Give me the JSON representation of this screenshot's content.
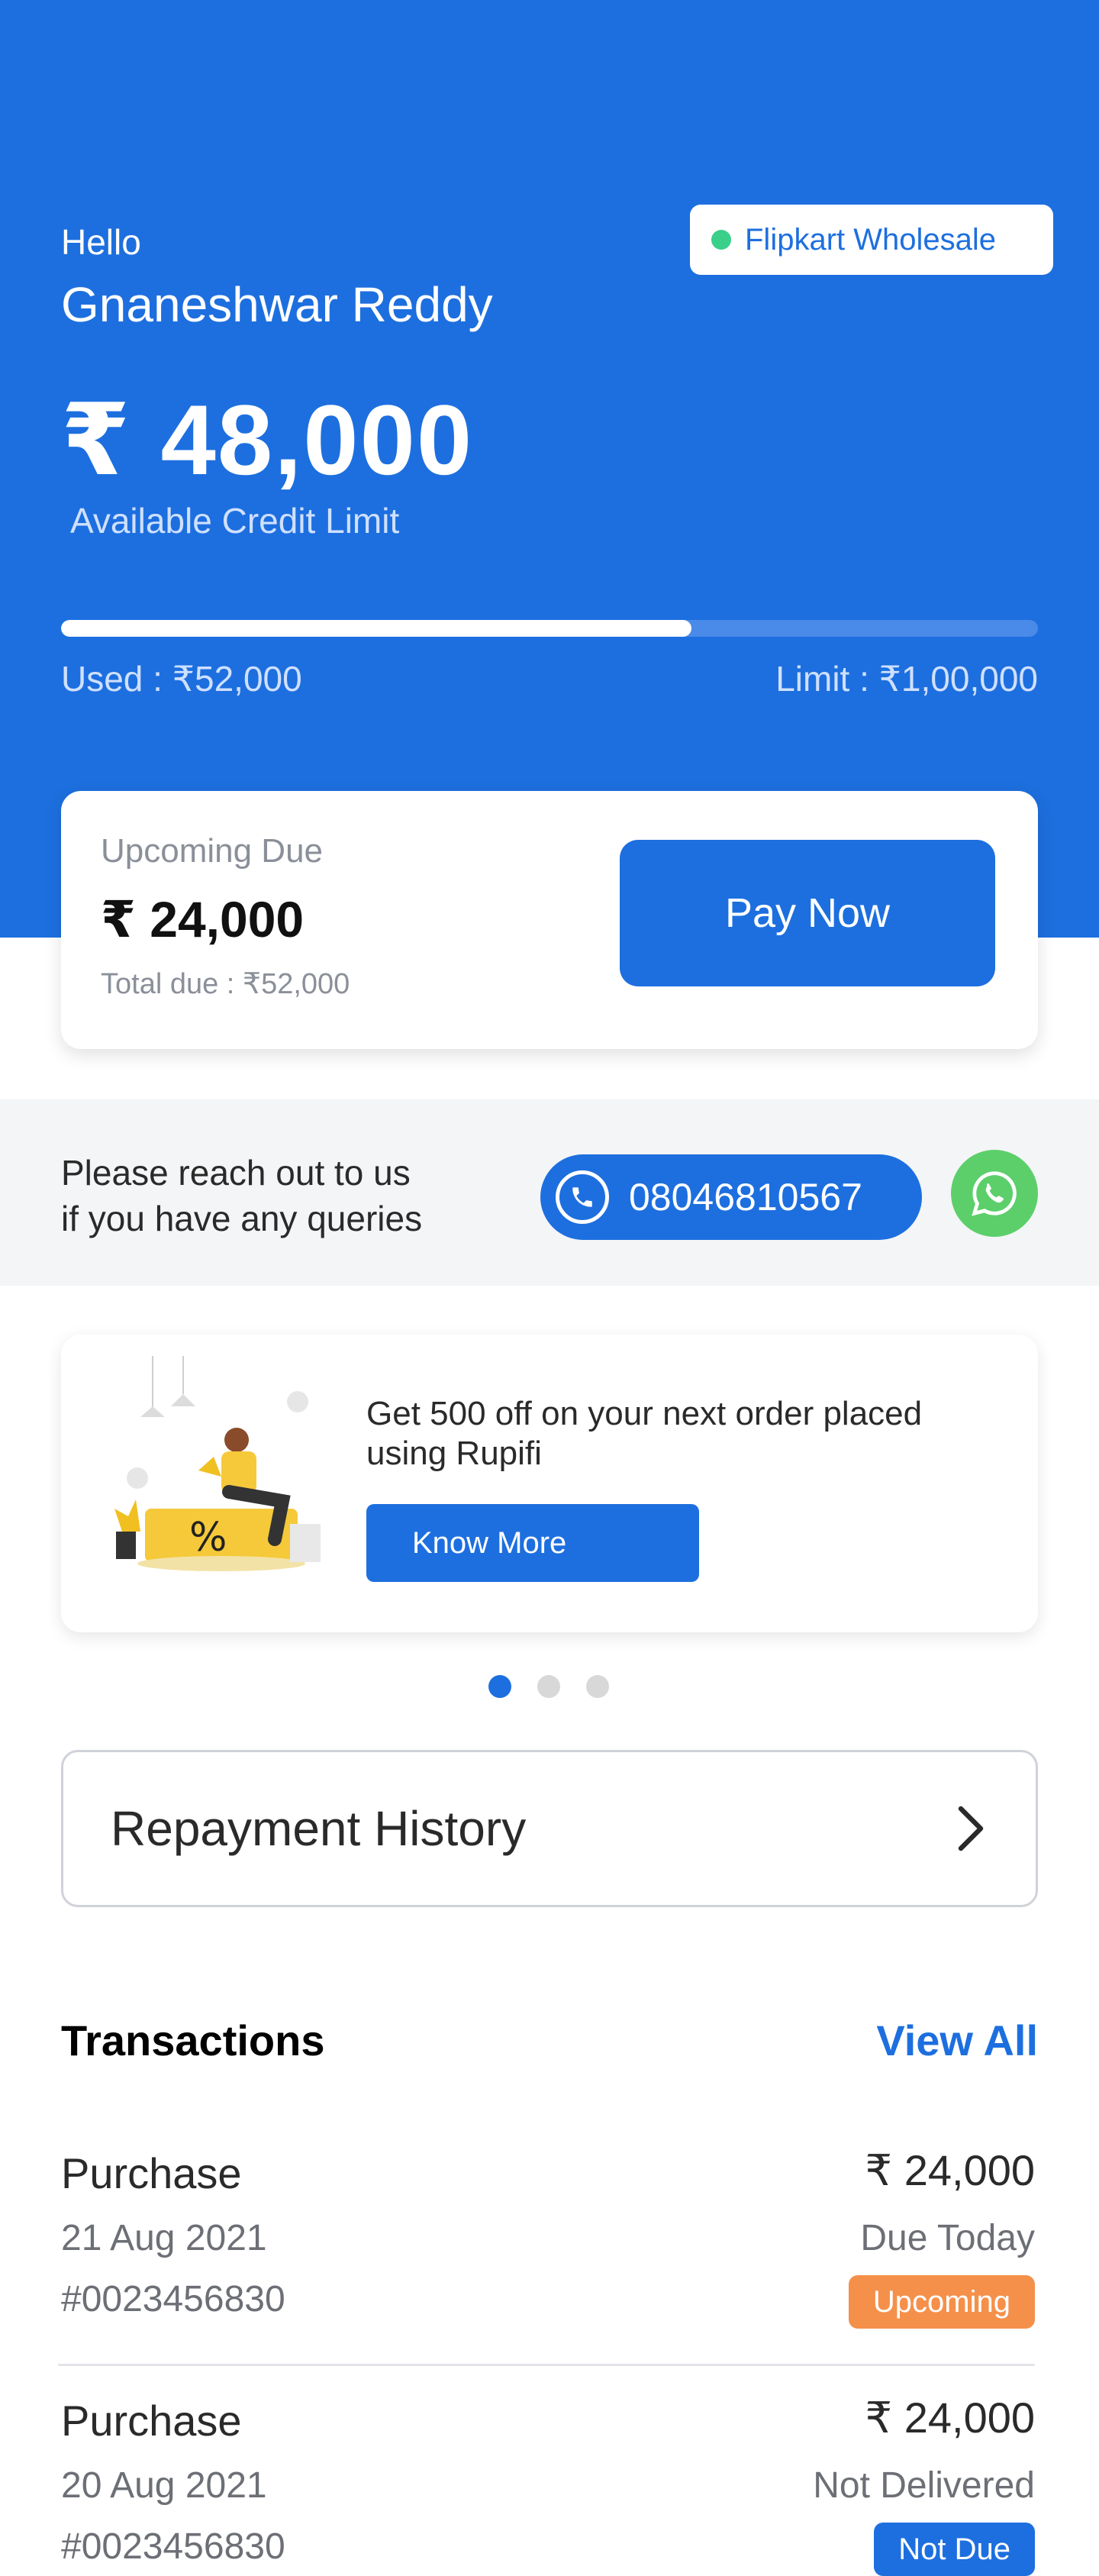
{
  "header": {
    "greeting": "Hello",
    "user_name": "Gnaneshwar Reddy",
    "partner_badge": "Flipkart Wholesale",
    "available_amount": "₹ 48,000",
    "available_label": "Available Credit Limit",
    "used_text": "Used :  ₹52,000",
    "limit_text": "Limit :  ₹1,00,000",
    "usage_fraction": 0.645
  },
  "due_card": {
    "label": "Upcoming Due",
    "amount": "₹ 24,000",
    "total_due": "Total due : ₹52,000",
    "pay_label": "Pay Now"
  },
  "support": {
    "line1": "Please reach out to us",
    "line2": "if you have any queries",
    "phone": "08046810567"
  },
  "promo": {
    "text": "Get 500 off on your next order placed using Rupifi",
    "button_label": "Know More",
    "carousel_count": 3,
    "active_index": 0
  },
  "repayment": {
    "label": "Repayment History"
  },
  "transactions": {
    "title": "Transactions",
    "view_all": "View All",
    "items": [
      {
        "type": "Purchase",
        "date": "21 Aug 2021",
        "id": "#0023456830",
        "amount": "₹ 24,000",
        "status": "Due Today",
        "tag": "Upcoming",
        "tag_color": "#f5904a"
      },
      {
        "type": "Purchase",
        "date": "20 Aug 2021",
        "id": "#0023456830",
        "amount": "₹ 24,000",
        "status": "Not Delivered",
        "tag": "Not Due",
        "tag_color": "#1d6fdf"
      }
    ]
  },
  "colors": {
    "primary": "#1d6fdf",
    "badge_dot": "#3ad08a",
    "whatsapp": "#5ccf6b",
    "upcoming": "#f5904a"
  }
}
